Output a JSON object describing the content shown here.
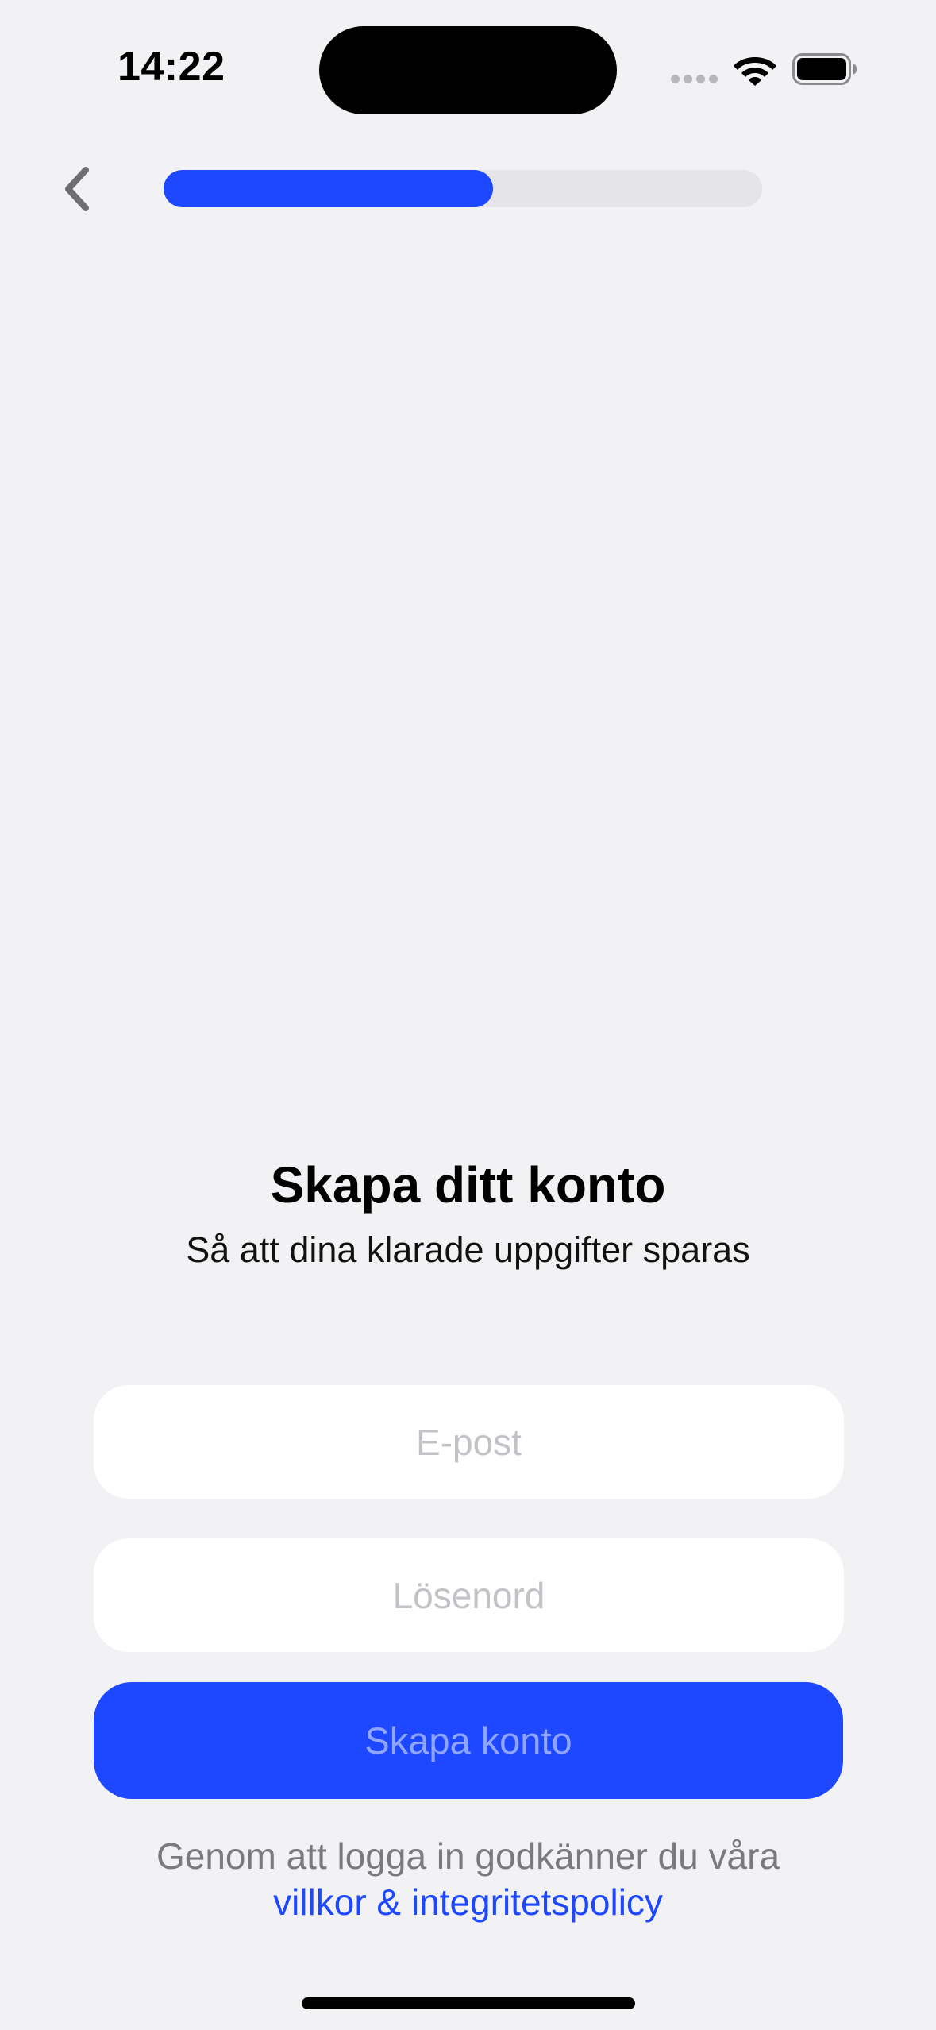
{
  "status_bar": {
    "time": "14:22",
    "icons": [
      "cellular-signal-icon",
      "wifi-icon",
      "battery-icon"
    ]
  },
  "nav": {
    "back_icon": "chevron-left-icon",
    "progress_fraction": 0.55
  },
  "header": {
    "title": "Skapa ditt konto",
    "subtitle": "Så att dina klarade uppgifter sparas"
  },
  "form": {
    "email_placeholder": "E-post",
    "email_value": "",
    "password_placeholder": "Lösenord",
    "password_value": "",
    "submit_label": "Skapa konto"
  },
  "footer": {
    "terms_text": "Genom att logga in godkänner du våra",
    "terms_link": "villkor & integritetspolicy"
  },
  "colors": {
    "background": "#f2f2f4",
    "accent": "#1e48ff",
    "disabled_label": "#8fa5ff",
    "muted_text": "#7a7a7e",
    "placeholder": "#c3c3c7",
    "track": "#e5e5e7"
  }
}
